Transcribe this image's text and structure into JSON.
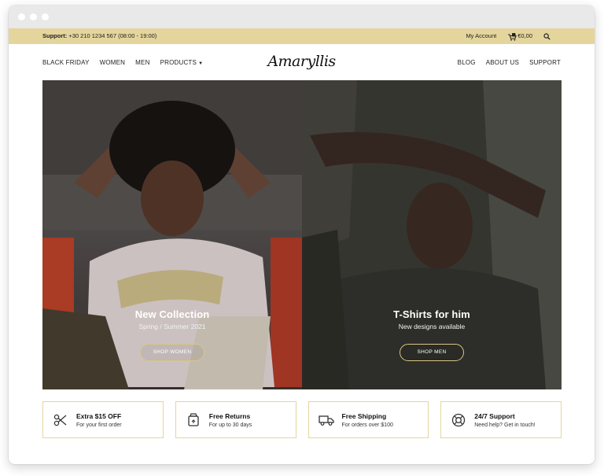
{
  "topbar": {
    "support_label": "Support:",
    "support_text": "+30 210 1234 567 (08:00 - 19:00)",
    "account": "My Account",
    "cart_total": "€0,00",
    "cart_count": "0"
  },
  "nav": {
    "left": [
      "BLACK FRIDAY",
      "WOMEN",
      "MEN",
      "PRODUCTS"
    ],
    "logo": "Amaryllis",
    "right": [
      "BLOG",
      "ABOUT US",
      "SUPPORT"
    ]
  },
  "hero": {
    "women": {
      "title": "New Collection",
      "subtitle": "Spring / Summer 2021",
      "button": "SHOP WOMEN"
    },
    "men": {
      "title": "T-Shirts for him",
      "subtitle": "New designs available",
      "button": "SHOP MEN"
    }
  },
  "features": [
    {
      "title": "Extra $15 OFF",
      "subtitle": "For your first order",
      "icon": "scissors-icon"
    },
    {
      "title": "Free Returns",
      "subtitle": "For up to 30 days",
      "icon": "return-box-icon"
    },
    {
      "title": "Free Shipping",
      "subtitle": "For orders over $100",
      "icon": "truck-icon"
    },
    {
      "title": "24/7 Support",
      "subtitle": "Need help? Get in touch!",
      "icon": "lifebuoy-icon"
    }
  ],
  "colors": {
    "accent": "#e4d59c",
    "button_border": "#d9c585"
  }
}
